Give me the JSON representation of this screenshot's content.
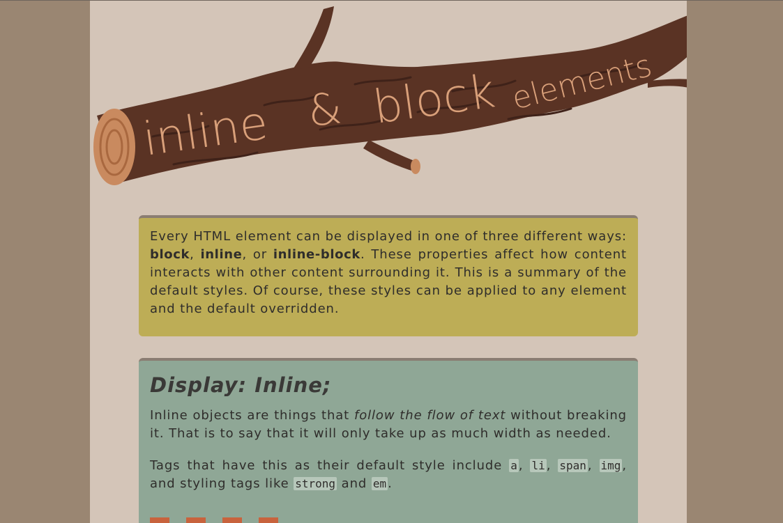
{
  "banner": {
    "title_word1": "inline",
    "title_amp": "&",
    "title_word2": "block",
    "title_word3": "elements",
    "colors": {
      "bark": "#5c3425",
      "bark_dark": "#3f2219",
      "wood": "#c98a5f",
      "lettering": "#d9a07a"
    }
  },
  "intro": {
    "p1_a": "Every HTML element can be displayed in one of three different ways: ",
    "block": "block",
    "sep1": ", ",
    "inline": "inline",
    "sep2": ", or ",
    "inline_block": "inline-block",
    "p1_b": ". These properties affect how content interacts with other content surrounding it. This is a summary of the default styles. Of course, these styles can be applied to any element and the default overridden."
  },
  "inline_section": {
    "heading": "Display: Inline;",
    "p1_a": "Inline objects are things that ",
    "p1_em": "follow the flow of text",
    "p1_b": " without breaking it. That is to say that it will only take up as much width as needed.",
    "p2_a": "Tags that have this as their default style include ",
    "tag_a": "a",
    "c1": ", ",
    "tag_li": "li",
    "c2": ", ",
    "tag_span": "span",
    "c3": ", ",
    "tag_img": "img",
    "p2_b": ", and styling tags like ",
    "tag_strong": "strong",
    "p2_c": " and ",
    "tag_em": "em",
    "p2_d": "."
  },
  "colors": {
    "background": "#9a8672",
    "page": "#d4c5b8",
    "intro_card": "#bdad56",
    "inline_card": "#8fa796",
    "swatch": "#c8633d"
  }
}
